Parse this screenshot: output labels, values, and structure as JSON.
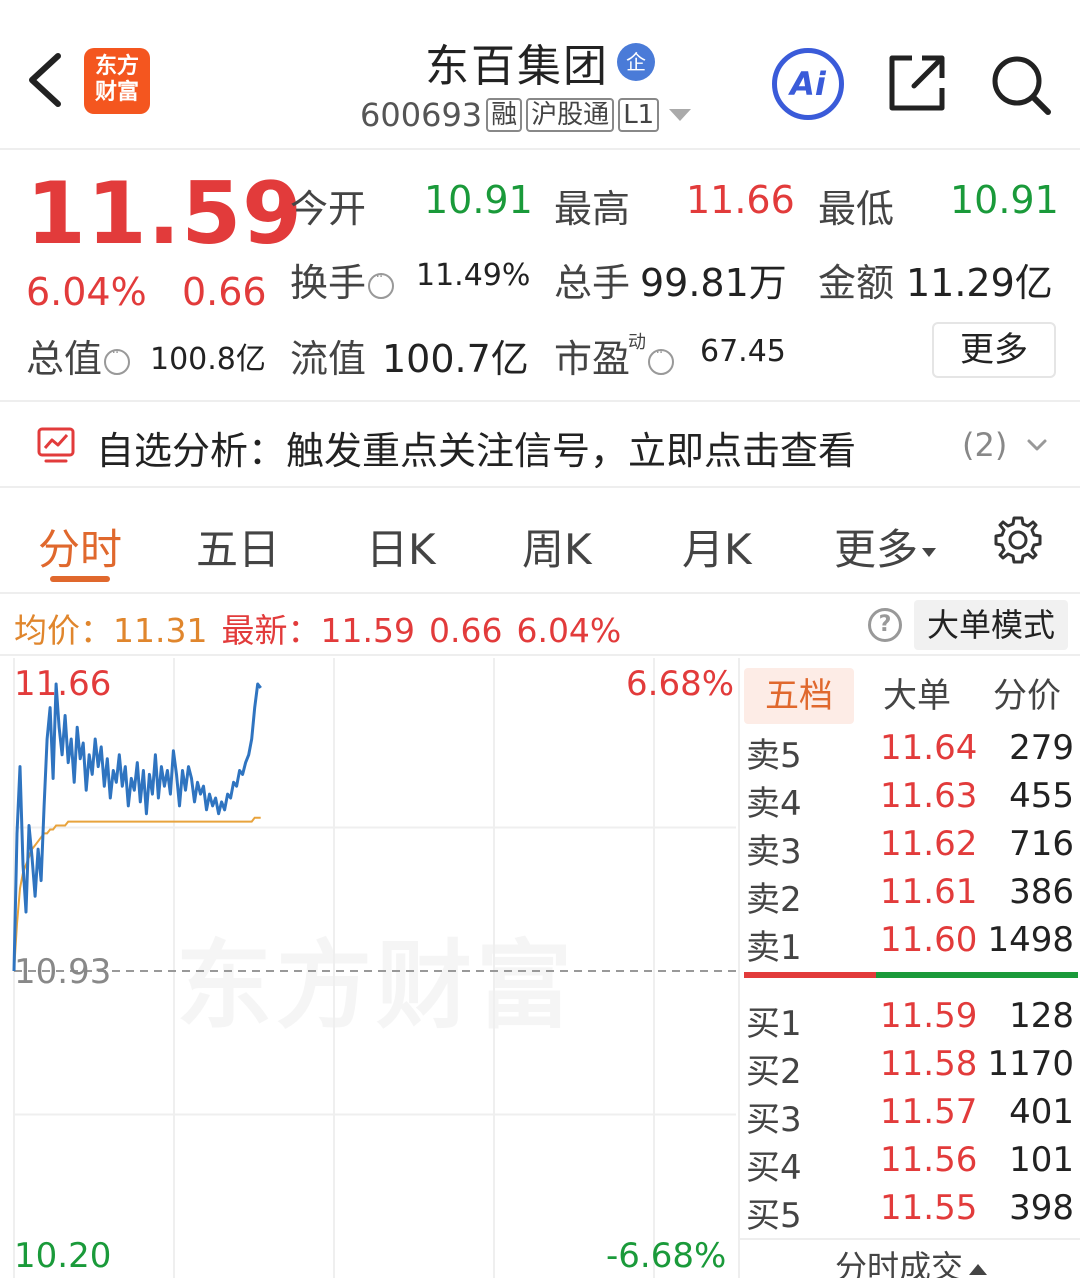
{
  "header": {
    "logo_text": "东方\n财富",
    "title": "东百集团",
    "badge": "企",
    "code": "600693",
    "tags": [
      "融",
      "沪股通",
      "L1"
    ],
    "ai_label": "Ai"
  },
  "quote": {
    "price": "11.59",
    "change_pct": "6.04%",
    "change_amt": "0.66",
    "fields": {
      "open_label": "今开",
      "open": "10.91",
      "high_label": "最高",
      "high": "11.66",
      "low_label": "最低",
      "low": "10.91",
      "turnover_label": "换手",
      "turnover": "11.49%",
      "volume_label": "总手",
      "volume": "99.81万",
      "amount_label": "金额",
      "amount": "11.29亿",
      "mktcap_label": "总值",
      "mktcap": "100.8亿",
      "float_label": "流值",
      "float": "100.7亿",
      "pe_label": "市盈",
      "pe_sup": "动",
      "pe": "67.45"
    },
    "more_label": "更多"
  },
  "analysis": {
    "text": "自选分析：触发重点关注信号，立即点击查看",
    "count": "(2)"
  },
  "tabs": [
    {
      "label": "分时",
      "active": true
    },
    {
      "label": "五日"
    },
    {
      "label": "日K"
    },
    {
      "label": "周K"
    },
    {
      "label": "月K"
    },
    {
      "label": "更多"
    }
  ],
  "infoline": {
    "avg_label": "均价：",
    "avg": "11.31",
    "latest_label": "最新：",
    "latest": "11.59",
    "change": "0.66",
    "pct": "6.04%",
    "help": "?",
    "big_mode": "大单模式"
  },
  "chart": {
    "y_top": "11.66",
    "y_mid": "10.93",
    "y_bot": "10.20",
    "pct_top": "6.68%",
    "pct_bot": "-6.68%",
    "watermark": "东方财富",
    "colors": {
      "price": "#2f74c0",
      "avg": "#e8a33c",
      "up": "#e23b3b",
      "down": "#1a9a3a"
    }
  },
  "chart_data": {
    "type": "line",
    "title": "",
    "xlabel": "",
    "ylabel": "",
    "ylim": [
      10.2,
      11.66
    ],
    "prev_close": 10.93,
    "series": [
      {
        "values": [
          10.93,
          11.28,
          11.45,
          11.2,
          11.08,
          11.3,
          11.22,
          11.12,
          11.24,
          11.16,
          11.35,
          11.52,
          11.6,
          11.42,
          11.66,
          11.55,
          11.48,
          11.58,
          11.46,
          11.52,
          11.41,
          11.55,
          11.47,
          11.51,
          11.39,
          11.48,
          11.43,
          11.52,
          11.45,
          11.5,
          11.4,
          11.47,
          11.37,
          11.44,
          11.41,
          11.48,
          11.4,
          11.45,
          11.35,
          11.42,
          11.39,
          11.46,
          11.36,
          11.44,
          11.33,
          11.43,
          11.38,
          11.48,
          11.37,
          11.45,
          11.4,
          11.44,
          11.38,
          11.49,
          11.43,
          11.35,
          11.44,
          11.39,
          11.45,
          11.42,
          11.36,
          11.41,
          11.38,
          11.4,
          11.34,
          11.38,
          11.35,
          11.37,
          11.33,
          11.36,
          11.34,
          11.38,
          11.37,
          11.41,
          11.4,
          11.44,
          11.43,
          11.46,
          11.48,
          11.52,
          11.6,
          11.66,
          11.65
        ]
      },
      {
        "values": [
          10.93,
          11.05,
          11.14,
          11.18,
          11.2,
          11.22,
          11.24,
          11.25,
          11.26,
          11.27,
          11.28,
          11.28,
          11.29,
          11.29,
          11.3,
          11.3,
          11.3,
          11.3,
          11.31,
          11.31,
          11.31,
          11.31,
          11.31,
          11.31,
          11.31,
          11.31,
          11.31,
          11.31,
          11.31,
          11.31,
          11.31,
          11.31,
          11.31,
          11.31,
          11.31,
          11.31,
          11.31,
          11.31,
          11.31,
          11.31,
          11.31,
          11.31,
          11.31,
          11.31,
          11.31,
          11.31,
          11.31,
          11.31,
          11.31,
          11.31,
          11.31,
          11.31,
          11.31,
          11.31,
          11.31,
          11.31,
          11.31,
          11.31,
          11.31,
          11.31,
          11.31,
          11.31,
          11.31,
          11.31,
          11.31,
          11.31,
          11.31,
          11.31,
          11.31,
          11.31,
          11.31,
          11.31,
          11.31,
          11.31,
          11.31,
          11.31,
          11.31,
          11.31,
          11.31,
          11.31,
          11.32,
          11.32,
          11.32
        ]
      }
    ]
  },
  "book": {
    "tabs": [
      "五档",
      "大单",
      "分价"
    ],
    "asks": [
      {
        "label": "卖5",
        "price": "11.64",
        "vol": "279"
      },
      {
        "label": "卖4",
        "price": "11.63",
        "vol": "455"
      },
      {
        "label": "卖3",
        "price": "11.62",
        "vol": "716"
      },
      {
        "label": "卖2",
        "price": "11.61",
        "vol": "386"
      },
      {
        "label": "卖1",
        "price": "11.60",
        "vol": "1498"
      }
    ],
    "bids": [
      {
        "label": "买1",
        "price": "11.59",
        "vol": "128"
      },
      {
        "label": "买2",
        "price": "11.58",
        "vol": "1170"
      },
      {
        "label": "买3",
        "price": "11.57",
        "vol": "401"
      },
      {
        "label": "买4",
        "price": "11.56",
        "vol": "101"
      },
      {
        "label": "买5",
        "price": "11.55",
        "vol": "398"
      }
    ],
    "footer": "分时成交"
  }
}
